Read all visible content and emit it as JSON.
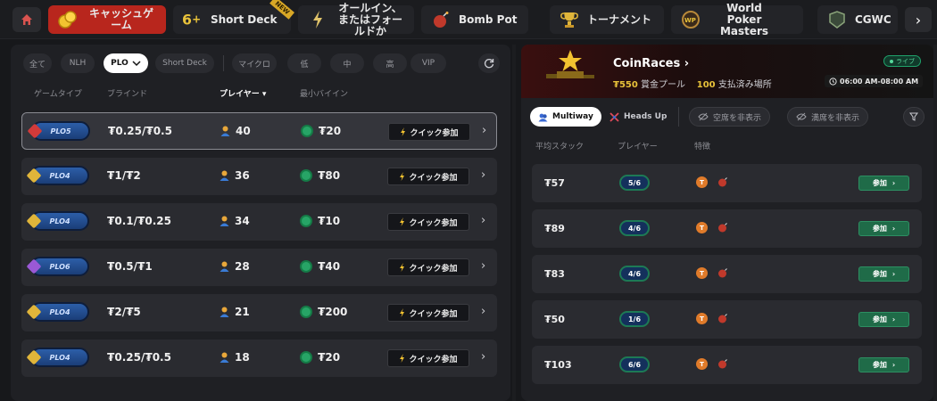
{
  "nav": {
    "tabs": [
      {
        "label": "キャッシュゲーム",
        "icon": "coins-icon"
      },
      {
        "label": "Short Deck",
        "icon": "six-plus-icon",
        "ribbon": "NEW"
      },
      {
        "label": "オールイン、またはフォールドか",
        "icon": "lightning-icon"
      },
      {
        "label": "Bomb Pot",
        "icon": "bomb-icon"
      },
      {
        "label": "トーナメント",
        "icon": "trophy-icon"
      },
      {
        "label": "World Poker Masters",
        "icon": "wpm-icon"
      },
      {
        "label": "CGWC",
        "icon": "cgwc-icon"
      }
    ]
  },
  "filters": {
    "chips": [
      "全て",
      "NLH",
      "PLO",
      "Short Deck",
      "マイクロ",
      "低",
      "中",
      "高",
      "VIP"
    ],
    "active": "PLO"
  },
  "lobby": {
    "columns": [
      "ゲームタイプ",
      "ブラインド",
      "プレイヤー",
      "最小バイイン"
    ],
    "sorted_column": "プレイヤー",
    "quick_join_label": "クイック参加",
    "rows": [
      {
        "game": "PLO5",
        "gem_color": "#d23a3a",
        "blinds": "₮0.25/₮0.5",
        "players": "40",
        "min_buyin": "₮20"
      },
      {
        "game": "PLO4",
        "gem_color": "#e0b53a",
        "blinds": "₮1/₮2",
        "players": "36",
        "min_buyin": "₮80"
      },
      {
        "game": "PLO4",
        "gem_color": "#e0b53a",
        "blinds": "₮0.1/₮0.25",
        "players": "34",
        "min_buyin": "₮10"
      },
      {
        "game": "PLO6",
        "gem_color": "#9b59d6",
        "blinds": "₮0.5/₮1",
        "players": "28",
        "min_buyin": "₮40"
      },
      {
        "game": "PLO4",
        "gem_color": "#e0b53a",
        "blinds": "₮2/₮5",
        "players": "21",
        "min_buyin": "₮200"
      },
      {
        "game": "PLO4",
        "gem_color": "#e0b53a",
        "blinds": "₮0.25/₮0.5",
        "players": "18",
        "min_buyin": "₮20"
      }
    ]
  },
  "race": {
    "title": "CoinRaces",
    "prize_value": "₮550",
    "prize_label": "賞金プール",
    "paid_value": "100",
    "paid_label": "支払済み場所",
    "live_label": "ライブ",
    "time": "06:00 AM-08:00 AM"
  },
  "tables": {
    "tabs": [
      "Multiway",
      "Heads Up"
    ],
    "toggles": [
      "空席を非表示",
      "満席を非表示"
    ],
    "columns": [
      "平均スタック",
      "プレイヤー",
      "特徴"
    ],
    "join_label": "参加",
    "rows": [
      {
        "stack": "₮57",
        "seats": "5/6"
      },
      {
        "stack": "₮89",
        "seats": "4/6"
      },
      {
        "stack": "₮83",
        "seats": "4/6"
      },
      {
        "stack": "₮50",
        "seats": "1/6"
      },
      {
        "stack": "₮103",
        "seats": "6/6"
      }
    ]
  }
}
